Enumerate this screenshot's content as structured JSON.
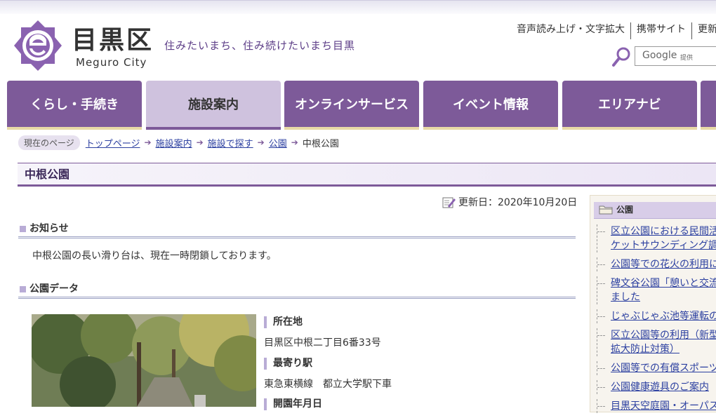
{
  "header": {
    "site_name": "目黒区",
    "site_name_en": "Meguro City",
    "tagline": "住みたいまち、住み続けたいまち目黒",
    "utility_links": [
      "音声読み上げ・文字拡大",
      "携帯サイト",
      "更新"
    ],
    "search_label": "Google",
    "search_provider": "提供"
  },
  "nav": {
    "tabs": [
      {
        "label": "くらし・手続き"
      },
      {
        "label": "施設案内"
      },
      {
        "label": "オンラインサービス"
      },
      {
        "label": "イベント情報"
      },
      {
        "label": "エリアナビ"
      }
    ],
    "active_tab": "施設案内"
  },
  "breadcrumb": {
    "here_label": "現在のページ",
    "links": [
      "トップページ",
      "施設案内",
      "施設で探す",
      "公園"
    ],
    "current": "中根公園"
  },
  "page": {
    "title": "中根公園",
    "updated": "更新日：2020年10月20日"
  },
  "notice": {
    "heading": "お知らせ",
    "text": "中根公園の長い滑り台は、現在一時閉鎖しております。"
  },
  "park_data": {
    "heading": "公園データ",
    "items": [
      {
        "label": "所在地",
        "value": "目黒区中根二丁目6番33号"
      },
      {
        "label": "最寄り駅",
        "value": "東急東横線　都立大学駅下車"
      },
      {
        "label": "開園年月日",
        "value": ""
      }
    ]
  },
  "sidebar": {
    "heading": "公園",
    "links": [
      [
        "区立公園における民間活",
        "ケットサウンディング調"
      ],
      [
        "公園等での花火の利用に"
      ],
      [
        "碑文谷公園「憩いと交流",
        "ました"
      ],
      [
        "じゃぶじゃぶ池等運転の"
      ],
      [
        "区立公園等の利用（新型",
        "拡大防止対策）"
      ],
      [
        "公園等での有償スポーツ"
      ],
      [
        "公園健康遊具のご案内"
      ],
      [
        "目黒天空庭園・オーパス"
      ]
    ]
  },
  "colors": {
    "brand_purple": "#7d5a99",
    "nav_active": "#cfc2de",
    "link_blue": "#2b3fa0"
  }
}
